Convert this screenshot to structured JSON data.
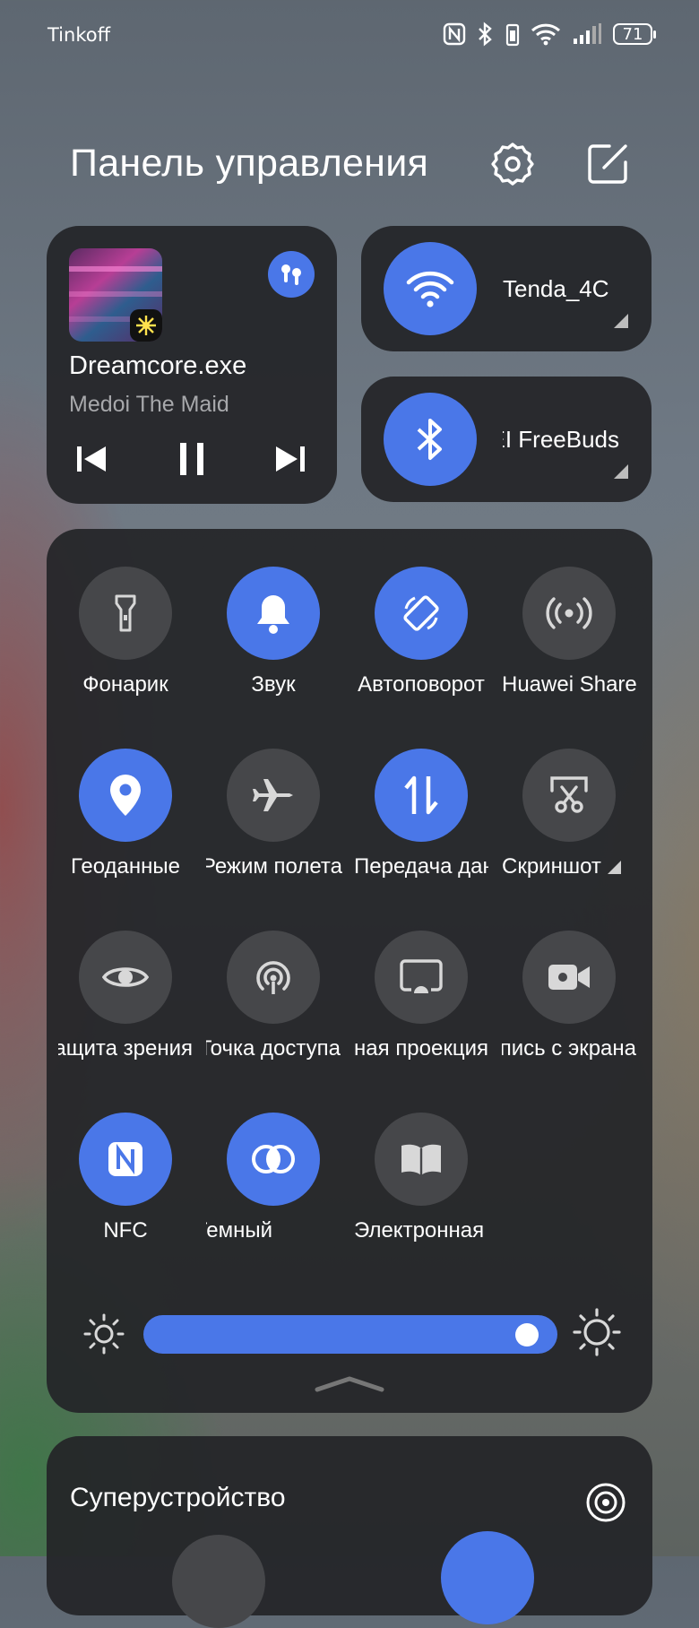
{
  "status_bar": {
    "carrier": "Tinkoff",
    "battery": "71",
    "icons": [
      "nfc-icon",
      "bluetooth-icon",
      "vibrate-icon",
      "wifi-icon",
      "signal-icon",
      "battery-icon"
    ]
  },
  "header": {
    "title": "Панель управления",
    "settings_icon": "gear-icon",
    "edit_icon": "edit-icon"
  },
  "media": {
    "song": "Dreamcore.exe",
    "artist": "Medoi The Maid",
    "output_icon": "earbuds-icon",
    "controls": [
      "previous-icon",
      "pause-icon",
      "next-icon"
    ]
  },
  "wifi": {
    "label": "Tenda_4C",
    "icon": "wifi-icon",
    "active": true
  },
  "bluetooth": {
    "label": "HUAWEI FreeBuds",
    "icon": "bluetooth-icon",
    "active": true
  },
  "toggles": [
    {
      "label": "Фонарик",
      "icon": "flashlight-icon",
      "active": false
    },
    {
      "label": "Звук",
      "icon": "bell-icon",
      "active": true
    },
    {
      "label": "Автоповорот",
      "icon": "rotate-icon",
      "active": true
    },
    {
      "label": "Huawei Share",
      "icon": "share-icon",
      "active": false
    },
    {
      "label": "Геоданные",
      "icon": "location-icon",
      "active": true
    },
    {
      "label": "Режим полета",
      "icon": "airplane-icon",
      "active": false
    },
    {
      "label": "Передача данных",
      "icon": "data-transfer-icon",
      "active": true
    },
    {
      "label": "Скриншот",
      "icon": "scissors-icon",
      "active": false
    },
    {
      "label": "Защита зрения",
      "icon": "eye-icon",
      "active": false
    },
    {
      "label": "Точка доступа",
      "icon": "hotspot-icon",
      "active": false
    },
    {
      "label": "Беспроводная проекция",
      "icon": "cast-icon",
      "active": false
    },
    {
      "label": "Запись с экрана",
      "icon": "video-camera-icon",
      "active": false
    },
    {
      "label": "NFC",
      "icon": "nfc-icon",
      "active": true
    },
    {
      "label": "Режим Темный",
      "icon": "dark-mode-icon",
      "active": true
    },
    {
      "label": "Электронная книга",
      "icon": "book-icon",
      "active": false
    }
  ],
  "brightness": {
    "level": 0.97,
    "icon_low": "sun-low-icon",
    "icon_high": "sun-high-icon"
  },
  "superdevice": {
    "title": "Суперустройство",
    "icon": "radar-icon"
  },
  "colors": {
    "accent": "#4a77e8",
    "card": "#242528",
    "tile_off": "#46474a"
  }
}
